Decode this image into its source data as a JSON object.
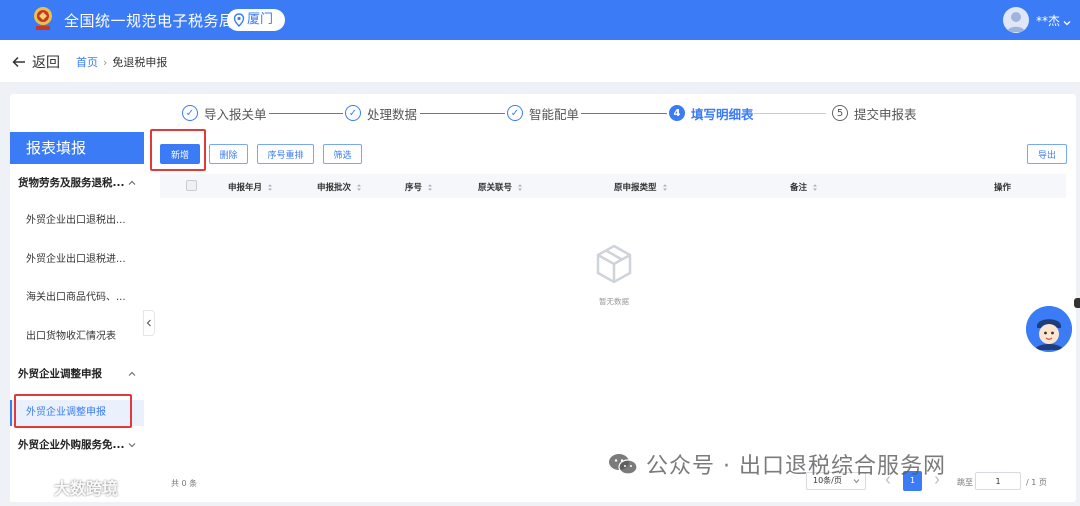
{
  "header": {
    "title": "全国统一规范电子税务局",
    "city": "厦门",
    "user_name": "**杰"
  },
  "breadcrumb": {
    "back_label": "返回",
    "home": "首页",
    "current": "免退税申报"
  },
  "steps": [
    {
      "label": "导入报关单",
      "marker": "✓",
      "state": "done"
    },
    {
      "label": "处理数据",
      "marker": "✓",
      "state": "done"
    },
    {
      "label": "智能配单",
      "marker": "✓",
      "state": "done"
    },
    {
      "label": "填写明细表",
      "marker": "4",
      "state": "active"
    },
    {
      "label": "提交申报表",
      "marker": "5",
      "state": "todo"
    }
  ],
  "sidebar": {
    "title": "报表填报",
    "groups": [
      {
        "label": "货物劳务及服务退税...",
        "expanded": true,
        "items": [
          {
            "label": "外贸企业出口退税出..."
          },
          {
            "label": "外贸企业出口退税进..."
          },
          {
            "label": "海关出口商品代码、..."
          },
          {
            "label": "出口货物收汇情况表"
          }
        ]
      },
      {
        "label": "外贸企业调整申报",
        "expanded": true,
        "items": [
          {
            "label": "外贸企业调整申报",
            "selected": true
          }
        ]
      },
      {
        "label": "外贸企业外购服务免...",
        "expanded": false,
        "items": []
      }
    ]
  },
  "toolbar": {
    "add": "新增",
    "delete": "删除",
    "reorder": "序号重排",
    "filter": "筛选",
    "export": "导出"
  },
  "table": {
    "columns": [
      "申报年月",
      "申报批次",
      "序号",
      "原关联号",
      "原申报类型",
      "备注",
      "操作"
    ],
    "rows": [],
    "empty_text": "暂无数据"
  },
  "pagination": {
    "total_label": "共 0 条",
    "page_size": "10条/页",
    "current_page": "1",
    "jump_label": "跳至",
    "jump_value": "1",
    "page_total": "/ 1 页"
  },
  "watermark": {
    "right": "公众号 · 出口退税综合服务网",
    "left": "大数跨境"
  },
  "colors": {
    "primary": "#3b7cf6",
    "highlight_box": "#e03a3a"
  }
}
